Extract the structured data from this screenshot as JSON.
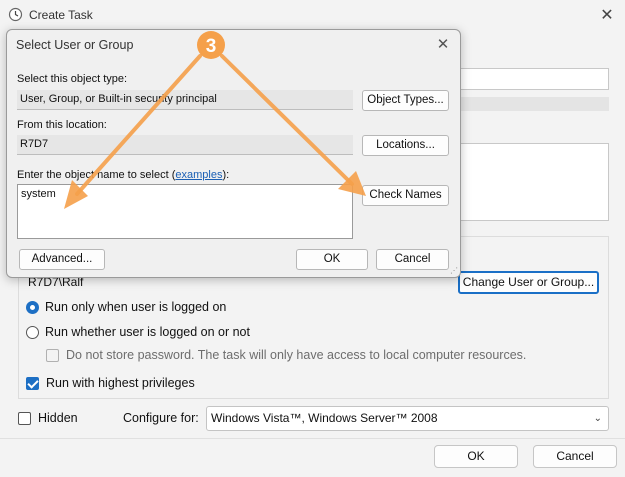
{
  "background_window": {
    "title": "Create Task",
    "user_account": "R7D7\\Ralf",
    "change_user_button": "Change User or Group...",
    "options": {
      "run_logged_on": "Run only when user is logged on",
      "run_whether": "Run whether user is logged on or not",
      "no_store_password": "Do not store password.  The task will only have access to local computer resources.",
      "highest_privileges": "Run with highest privileges"
    },
    "hidden_label": "Hidden",
    "configure_for_label": "Configure for:",
    "configure_for_value": "Windows Vista™, Windows Server™ 2008",
    "ok_button": "OK",
    "cancel_button": "Cancel"
  },
  "dialog": {
    "title": "Select User or Group",
    "object_type_label": "Select this object type:",
    "object_type_value": "User, Group, or Built-in security principal",
    "object_types_button": "Object Types...",
    "location_label": "From this location:",
    "location_value": "R7D7",
    "locations_button": "Locations...",
    "enter_name_prefix": "Enter the object name to select (",
    "examples_link": "examples",
    "enter_name_suffix": "):",
    "names_value": "system",
    "check_names_button": "Check Names",
    "advanced_button": "Advanced...",
    "ok_button": "OK",
    "cancel_button": "Cancel"
  },
  "annotation": {
    "step_number": "3",
    "color": "#f5a04a"
  }
}
